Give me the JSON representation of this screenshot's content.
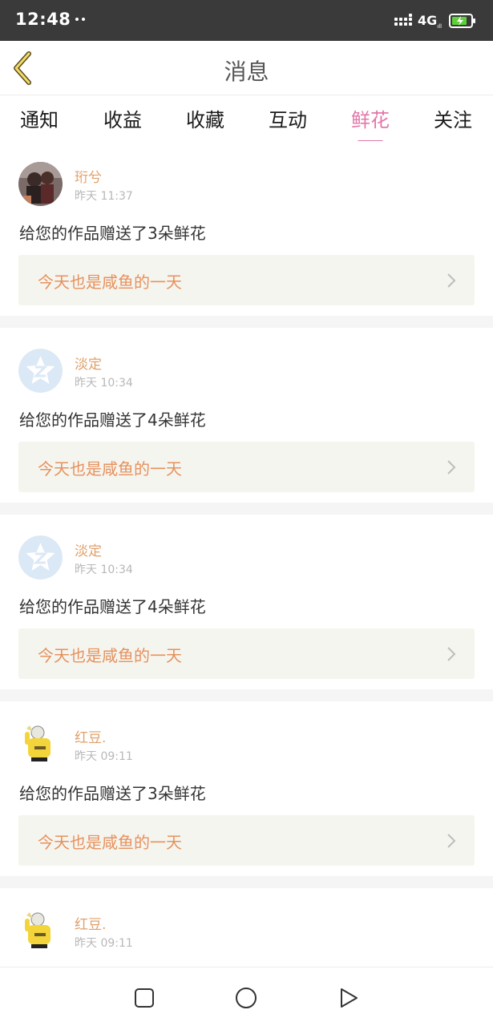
{
  "status_bar": {
    "time": "12:48",
    "network": "4G",
    "network_sub": "ıll",
    "battery_icon": "battery-charging-icon",
    "signal_icon": "signal-bars-icon"
  },
  "header": {
    "title": "消息",
    "back_icon": "chevron-left-icon"
  },
  "tabs": [
    {
      "label": "通知",
      "active": false
    },
    {
      "label": "收益",
      "active": false
    },
    {
      "label": "收藏",
      "active": false
    },
    {
      "label": "互动",
      "active": false
    },
    {
      "label": "鲜花",
      "active": true
    },
    {
      "label": "关注",
      "active": false
    }
  ],
  "colors": {
    "accent": "#e278a9",
    "username": "#e0a06a",
    "work_title": "#e6915e",
    "status_bar_bg": "#3a3a3a"
  },
  "messages": [
    {
      "user": "珩兮",
      "time": "昨天 11:37",
      "text": "给您的作品赠送了3朵鲜花",
      "work": "今天也是咸鱼的一天",
      "avatar": "photo-avatar"
    },
    {
      "user": "淡定",
      "time": "昨天 10:34",
      "text": "给您的作品赠送了4朵鲜花",
      "work": "今天也是咸鱼的一天",
      "avatar": "default-star-avatar"
    },
    {
      "user": "淡定",
      "time": "昨天 10:34",
      "text": "给您的作品赠送了4朵鲜花",
      "work": "今天也是咸鱼的一天",
      "avatar": "default-star-avatar"
    },
    {
      "user": "红豆.",
      "time": "昨天 09:11",
      "text": "给您的作品赠送了3朵鲜花",
      "work": "今天也是咸鱼的一天",
      "avatar": "cartoon-avatar"
    },
    {
      "user": "红豆.",
      "time": "昨天 09:11",
      "text": "",
      "work": "",
      "avatar": "cartoon-avatar"
    }
  ],
  "system_nav": {
    "recent_icon": "square-icon",
    "home_icon": "circle-icon",
    "back_icon": "triangle-back-icon"
  }
}
